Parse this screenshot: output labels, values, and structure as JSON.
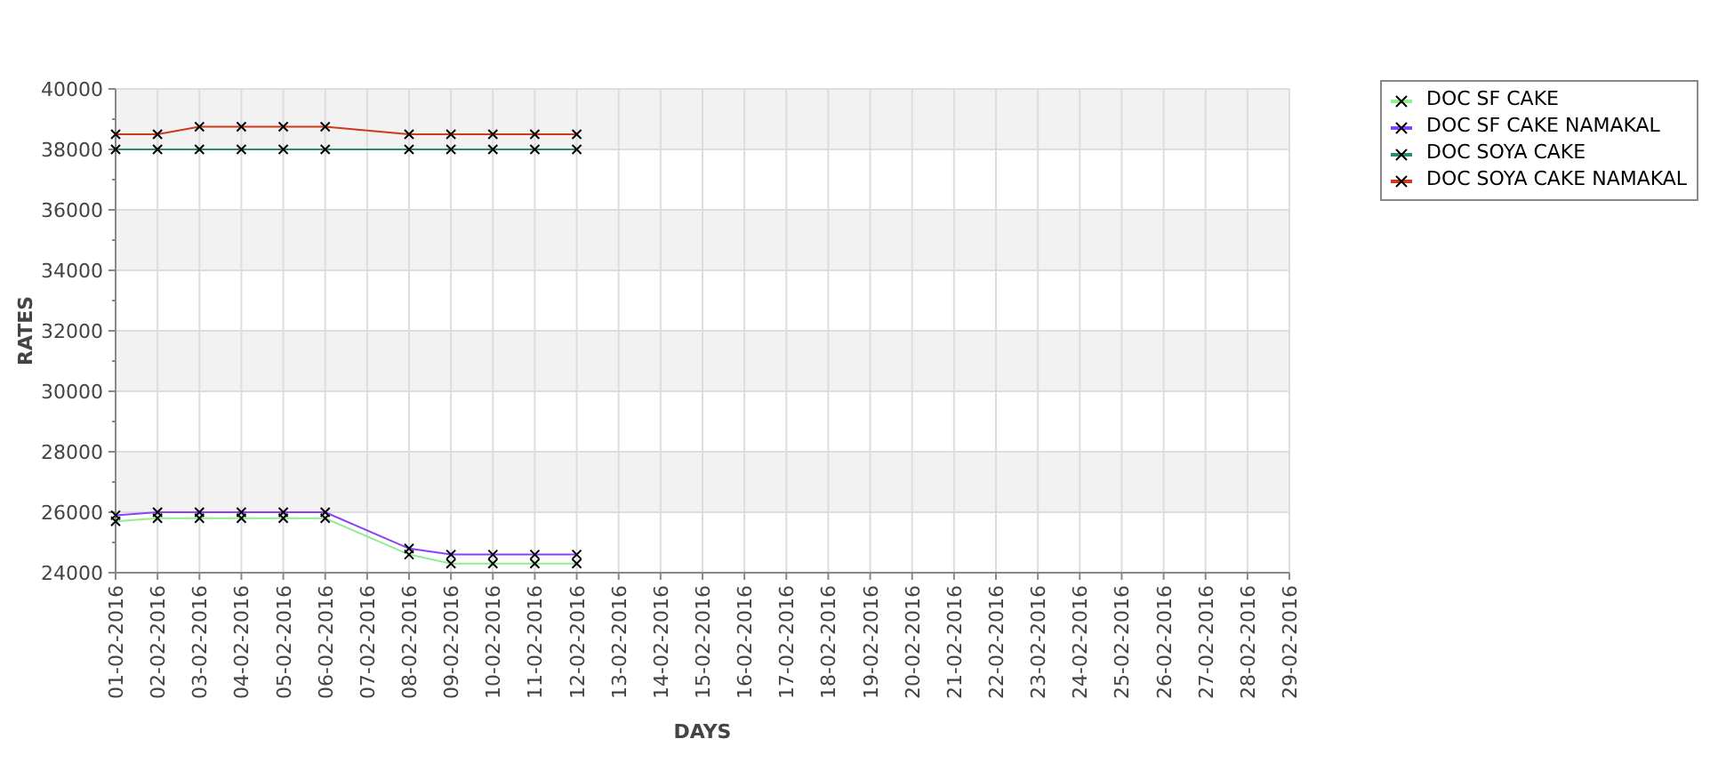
{
  "chart_data": {
    "type": "line",
    "xlabel": "DAYS",
    "ylabel": "RATES",
    "categories": [
      "01-02-2016",
      "02-02-2016",
      "03-02-2016",
      "04-02-2016",
      "05-02-2016",
      "06-02-2016",
      "07-02-2016",
      "08-02-2016",
      "09-02-2016",
      "10-02-2016",
      "11-02-2016",
      "12-02-2016",
      "13-02-2016",
      "14-02-2016",
      "15-02-2016",
      "16-02-2016",
      "17-02-2016",
      "18-02-2016",
      "19-02-2016",
      "20-02-2016",
      "21-02-2016",
      "22-02-2016",
      "23-02-2016",
      "24-02-2016",
      "25-02-2016",
      "26-02-2016",
      "27-02-2016",
      "28-02-2016",
      "29-02-2016"
    ],
    "ylim": [
      24000,
      40000
    ],
    "grid": true,
    "yticks": [
      24000,
      26000,
      28000,
      30000,
      32000,
      34000,
      36000,
      38000,
      40000
    ],
    "series": [
      {
        "name": "DOC SF CAKE",
        "color": "#90ee90",
        "marker": "x",
        "values": [
          25700,
          25800,
          25800,
          25800,
          25800,
          25800,
          null,
          24600,
          24300,
          24300,
          24300,
          24300,
          null,
          null,
          null,
          null,
          null,
          null,
          null,
          null,
          null,
          null,
          null,
          null,
          null,
          null,
          null,
          null,
          null
        ]
      },
      {
        "name": "DOC SF CAKE NAMAKAL",
        "color": "#8a3ffc",
        "marker": "x",
        "values": [
          25900,
          26000,
          26000,
          26000,
          26000,
          26000,
          null,
          24800,
          24600,
          24600,
          24600,
          24600,
          null,
          null,
          null,
          null,
          null,
          null,
          null,
          null,
          null,
          null,
          null,
          null,
          null,
          null,
          null,
          null,
          null
        ]
      },
      {
        "name": "DOC SOYA CAKE",
        "color": "#2e8b68",
        "marker": "x",
        "values": [
          38000,
          38000,
          38000,
          38000,
          38000,
          38000,
          null,
          38000,
          38000,
          38000,
          38000,
          38000,
          null,
          null,
          null,
          null,
          null,
          null,
          null,
          null,
          null,
          null,
          null,
          null,
          null,
          null,
          null,
          null,
          null
        ]
      },
      {
        "name": "DOC SOYA CAKE NAMAKAL",
        "color": "#cc3a1a",
        "marker": "x",
        "values": [
          38500,
          38500,
          38750,
          38750,
          38750,
          38750,
          null,
          38500,
          38500,
          38500,
          38500,
          38500,
          null,
          null,
          null,
          null,
          null,
          null,
          null,
          null,
          null,
          null,
          null,
          null,
          null,
          null,
          null,
          null,
          null
        ]
      }
    ]
  }
}
